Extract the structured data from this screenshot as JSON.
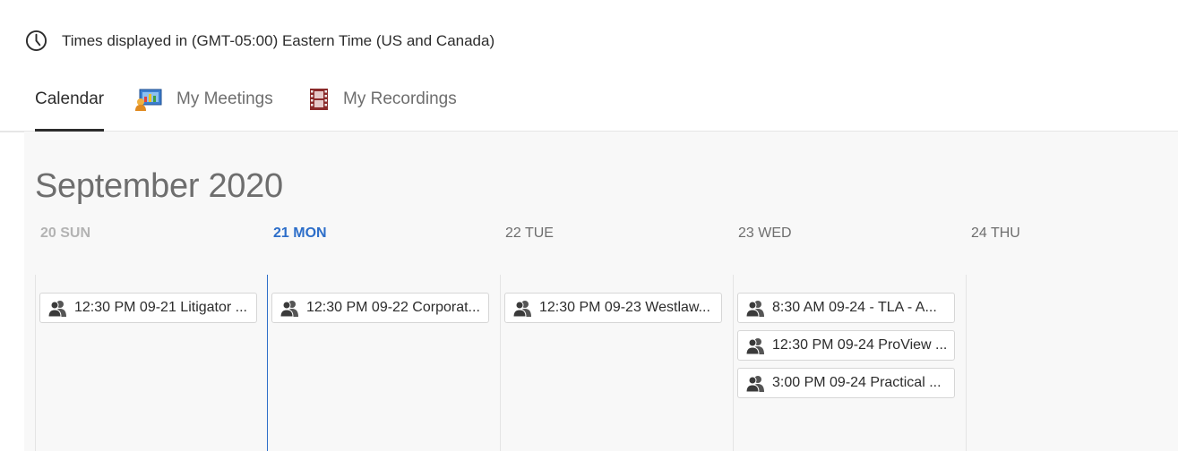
{
  "timezone": {
    "text": "Times displayed in (GMT-05:00) Eastern Time (US and Canada)",
    "icon": "clock-icon"
  },
  "tabs": [
    {
      "label": "Calendar",
      "icon": "",
      "active": true
    },
    {
      "label": "My Meetings",
      "icon": "meetings-icon",
      "active": false
    },
    {
      "label": "My Recordings",
      "icon": "film-reel-icon",
      "active": false
    }
  ],
  "calendar": {
    "month_title": "September 2020",
    "accent_color": "#2d6ec9",
    "days": [
      {
        "label": "20 SUN",
        "events": [
          "12:30 PM 09-21 Litigator ..."
        ]
      },
      {
        "label": "21 MON",
        "today": true,
        "events": [
          "12:30 PM 09-22 Corporat..."
        ]
      },
      {
        "label": "22 TUE",
        "events": [
          "12:30 PM 09-23 Westlaw..."
        ]
      },
      {
        "label": "23 WED",
        "events": [
          "8:30 AM 09-24 - TLA - A...",
          "12:30 PM 09-24 ProView ...",
          "3:00 PM 09-24 Practical ..."
        ]
      },
      {
        "label": "24 THU",
        "events": []
      }
    ],
    "event_icon": "attendee-icon"
  }
}
